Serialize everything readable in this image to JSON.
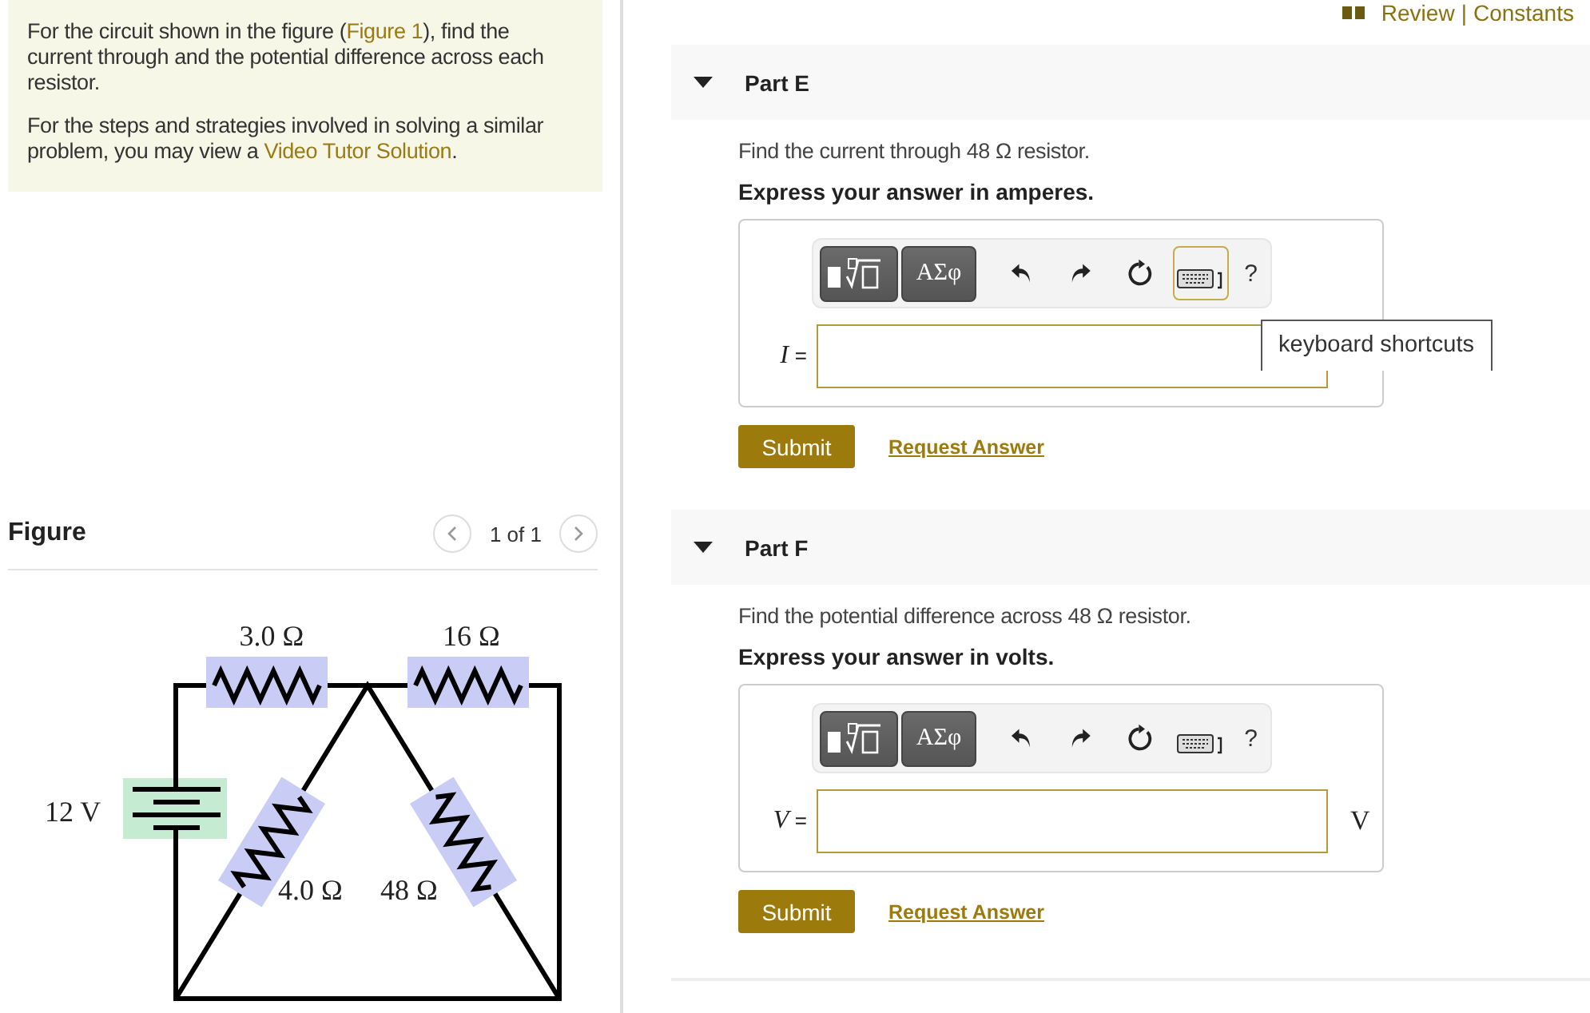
{
  "header": {
    "links": [
      "Review",
      "Constants"
    ],
    "separator": "|"
  },
  "intro": {
    "paragraphs": [
      [
        {
          "text": "For the circuit shown in the figure ("
        },
        {
          "link": "Figure 1"
        },
        {
          "text": "), find the current through and the potential difference across each resistor."
        }
      ],
      [
        {
          "text": "For the steps and strategies involved in solving a similar problem, you may view a "
        },
        {
          "link": "Video Tutor Solution"
        },
        {
          "text": "."
        }
      ]
    ]
  },
  "figure": {
    "title": "Figure",
    "pager": "1 of 1",
    "labels": {
      "r1": "3.0 Ω",
      "r2": "16 Ω",
      "battery": "12 V",
      "r3": "4.0 Ω",
      "r4": "48 Ω"
    }
  },
  "parts": [
    {
      "title": "Part E",
      "expanded": true,
      "prompt": "Find the current through 48 Ω resistor.",
      "instruction": "Express your answer in amperes.",
      "greek": "ΑΣφ",
      "help": "?",
      "keyboard_focused": true,
      "variable": "I",
      "equals": "=",
      "tooltip": "keyboard shortcuts",
      "submit": "Submit",
      "request": "Request Answer"
    },
    {
      "title": "Part F",
      "expanded": true,
      "prompt": "Find the potential difference across 48 Ω resistor.",
      "instruction": "Express your answer in volts.",
      "greek": "ΑΣφ",
      "help": "?",
      "keyboard_focused": false,
      "variable": "V",
      "equals": "=",
      "unit": "V",
      "submit": "Submit",
      "request": "Request Answer"
    }
  ]
}
